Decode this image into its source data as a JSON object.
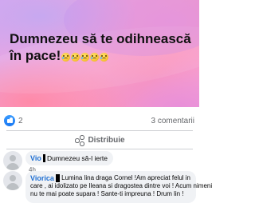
{
  "post": {
    "text_line1": "Dumnezeu să te odihnească",
    "text_line2": "în pace!",
    "emoji_icon": "crying-face-emoji",
    "emoji_count": 5,
    "background_colors": [
      "#d8a7f0",
      "#f4a3d4",
      "#ff98b6",
      "#f6a6da"
    ]
  },
  "engagement": {
    "reaction_icon": "like-icon",
    "reaction_count": "2",
    "comment_count": "3 comentarii"
  },
  "actions": {
    "share_label": "Distribuie",
    "share_icon": "share-icon"
  },
  "comments": [
    {
      "author": "Vio",
      "text": "Dumnezeu să-l ierte",
      "time": "4h",
      "avatar_icon": "default-avatar-icon"
    },
    {
      "author": "Viorica",
      "line1": "Lumina lina draga Cornel !Am apreciat felul in",
      "line2": "care , ai idolizato pe Ileana si dragostea dintre voi ! Acum nimeni",
      "line3": "nu te mai poate supara ! Sante-ti impreuna ! Drum lin !",
      "avatar_icon": "default-avatar-icon"
    }
  ],
  "colors": {
    "author_link": "#1f6fd1",
    "muted_text": "#65676b",
    "comment_bubble": "#f0f2f5",
    "like_blue": "#1877f2"
  }
}
